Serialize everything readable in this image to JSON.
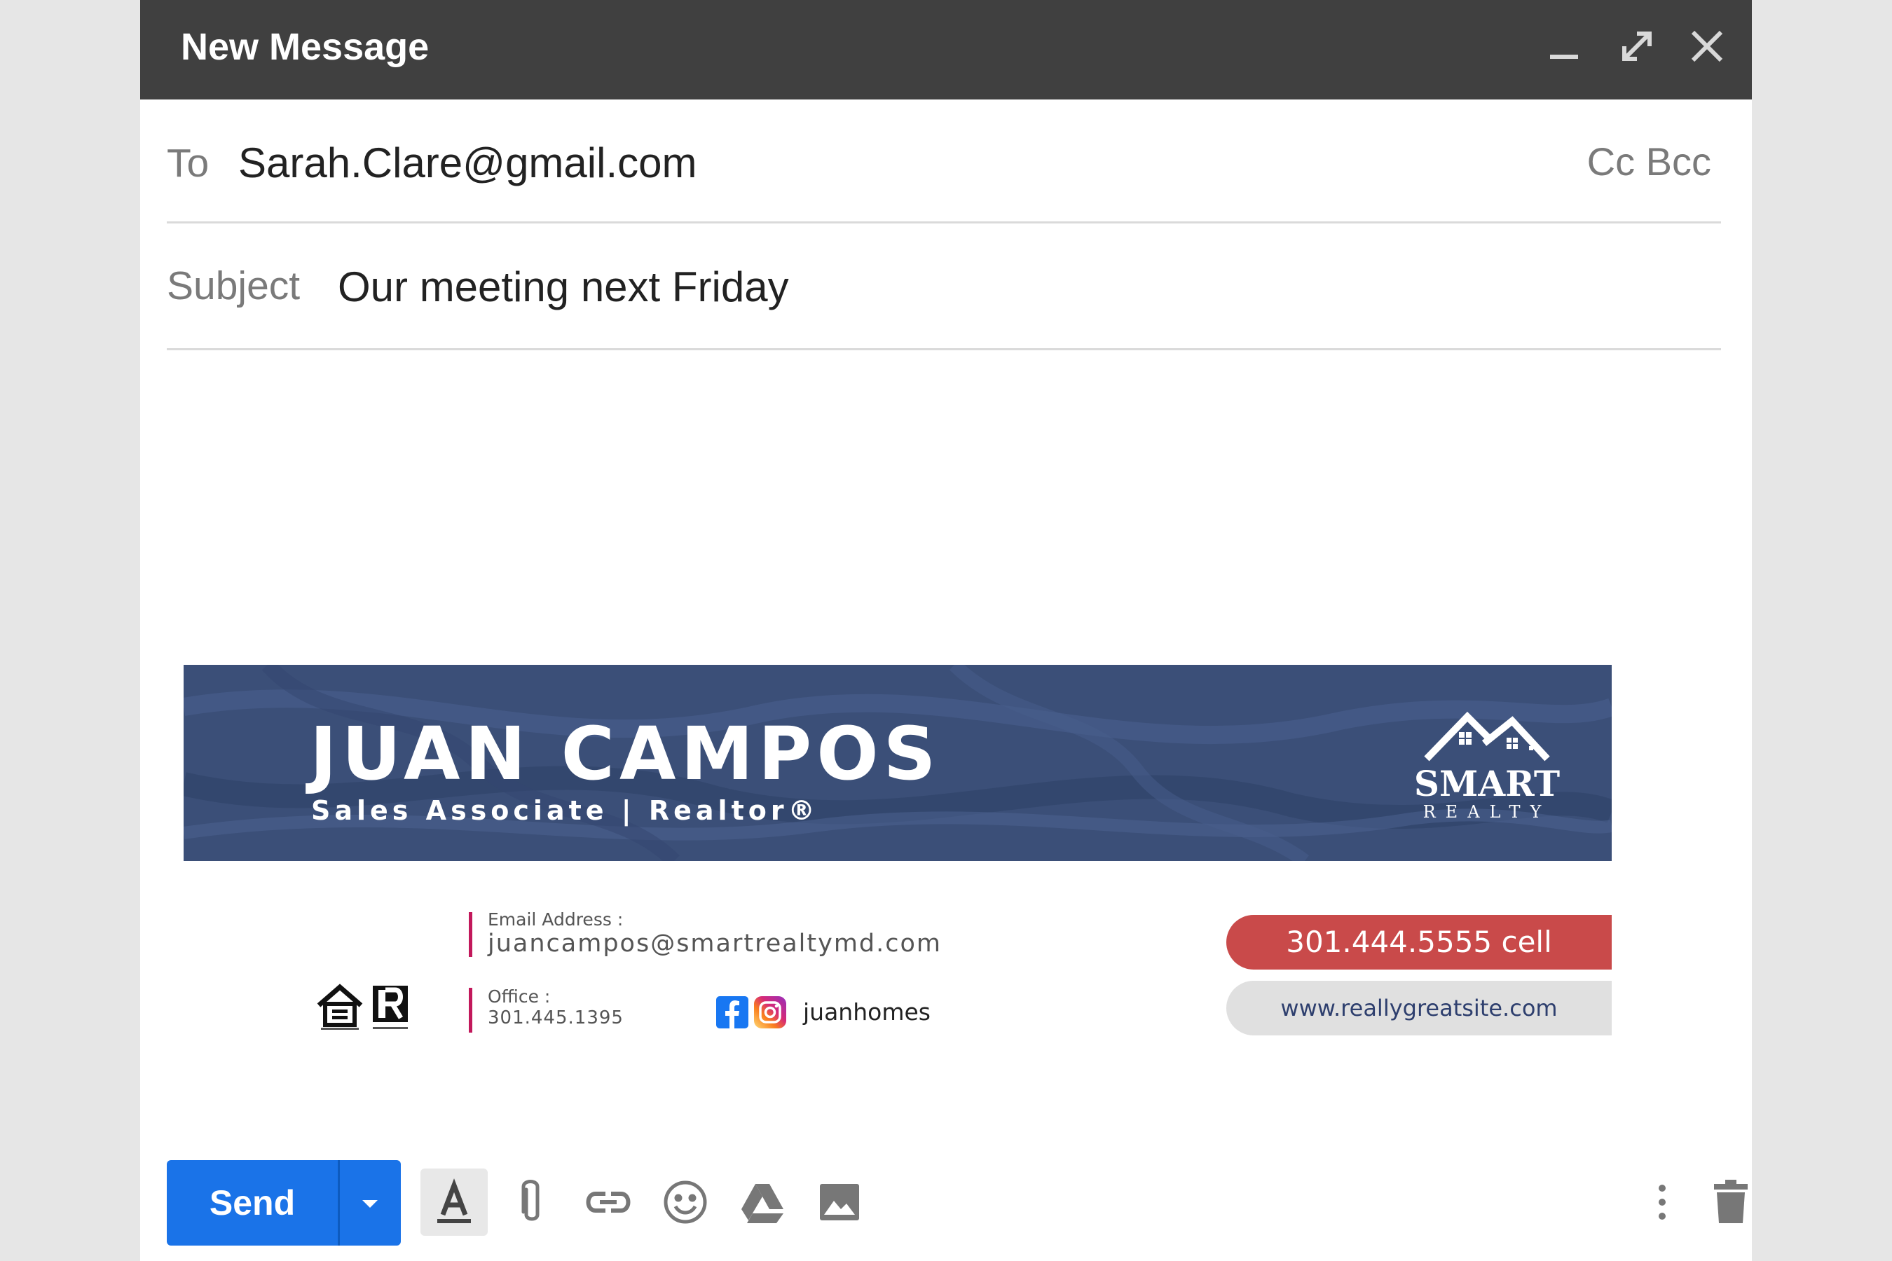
{
  "window": {
    "title": "New Message",
    "controls": [
      "minimize-icon",
      "expand-icon",
      "close-icon"
    ]
  },
  "recipients": {
    "to_label": "To",
    "to_value": "Sarah.Clare@gmail.com",
    "cc_label": "Cc",
    "bcc_label": "Bcc"
  },
  "subject": {
    "label": "Subject",
    "value": "Our meeting next Friday"
  },
  "signature": {
    "name": "JUAN CAMPOS",
    "role": "Sales Associate | Realtor®",
    "logo": {
      "line1": "SMART",
      "line2": "REALTY"
    },
    "email_label": "Email Address :",
    "email": "juancampos@smartrealtymd.com",
    "office_label": "Office  :",
    "office_phone": "301.445.1395",
    "social_handle": "juanhomes",
    "cell": "301.444.5555 cell",
    "website": "www.reallygreatsite.com",
    "colors": {
      "banner": "#3b4f78",
      "accent": "#c2185b",
      "cell_pill": "#c94a4a"
    }
  },
  "toolbar": {
    "send_label": "Send",
    "send_color": "#1a73e8",
    "tools": [
      "formatting-icon",
      "attach-icon",
      "link-icon",
      "emoji-icon",
      "drive-icon",
      "photo-icon"
    ],
    "right_tools": [
      "more-options-icon",
      "trash-icon"
    ]
  }
}
